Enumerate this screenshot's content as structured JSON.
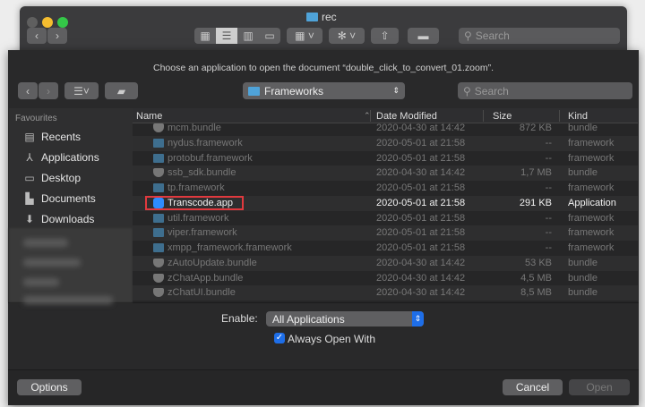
{
  "back_window": {
    "title": "rec",
    "search_placeholder": "Search"
  },
  "sheet": {
    "message": "Choose an application to open the document “double_click_to_convert_01.zoom”.",
    "location": "Frameworks",
    "search_placeholder": "Search"
  },
  "sidebar": {
    "section": "Favourites",
    "items": [
      {
        "label": "Recents",
        "icon": "recents-icon"
      },
      {
        "label": "Applications",
        "icon": "applications-icon"
      },
      {
        "label": "Desktop",
        "icon": "desktop-icon"
      },
      {
        "label": "Documents",
        "icon": "documents-icon"
      },
      {
        "label": "Downloads",
        "icon": "downloads-icon"
      }
    ]
  },
  "columns": {
    "name": "Name",
    "date": "Date Modified",
    "size": "Size",
    "kind": "Kind"
  },
  "files": [
    {
      "name": "mcm.bundle",
      "date": "2020-04-30 at 14:42",
      "size": "872 KB",
      "kind": "bundle",
      "icon": "bundle"
    },
    {
      "name": "nydus.framework",
      "date": "2020-05-01 at 21:58",
      "size": "--",
      "kind": "framework",
      "icon": "folder"
    },
    {
      "name": "protobuf.framework",
      "date": "2020-05-01 at 21:58",
      "size": "--",
      "kind": "framework",
      "icon": "folder"
    },
    {
      "name": "ssb_sdk.bundle",
      "date": "2020-04-30 at 14:42",
      "size": "1,7 MB",
      "kind": "bundle",
      "icon": "bundle"
    },
    {
      "name": "tp.framework",
      "date": "2020-05-01 at 21:58",
      "size": "--",
      "kind": "framework",
      "icon": "folder"
    },
    {
      "name": "Transcode.app",
      "date": "2020-05-01 at 21:58",
      "size": "291 KB",
      "kind": "Application",
      "icon": "app"
    },
    {
      "name": "util.framework",
      "date": "2020-05-01 at 21:58",
      "size": "--",
      "kind": "framework",
      "icon": "folder"
    },
    {
      "name": "viper.framework",
      "date": "2020-05-01 at 21:58",
      "size": "--",
      "kind": "framework",
      "icon": "folder"
    },
    {
      "name": "xmpp_framework.framework",
      "date": "2020-05-01 at 21:58",
      "size": "--",
      "kind": "framework",
      "icon": "folder"
    },
    {
      "name": "zAutoUpdate.bundle",
      "date": "2020-04-30 at 14:42",
      "size": "53 KB",
      "kind": "bundle",
      "icon": "bundle"
    },
    {
      "name": "zChatApp.bundle",
      "date": "2020-04-30 at 14:42",
      "size": "4,5 MB",
      "kind": "bundle",
      "icon": "bundle"
    },
    {
      "name": "zChatUI.bundle",
      "date": "2020-04-30 at 14:42",
      "size": "8,5 MB",
      "kind": "bundle",
      "icon": "bundle"
    }
  ],
  "bottom": {
    "enable_label": "Enable:",
    "enable_value": "All Applications",
    "always_open_with": "Always Open With",
    "always_checked": true,
    "options": "Options",
    "cancel": "Cancel",
    "open": "Open"
  }
}
